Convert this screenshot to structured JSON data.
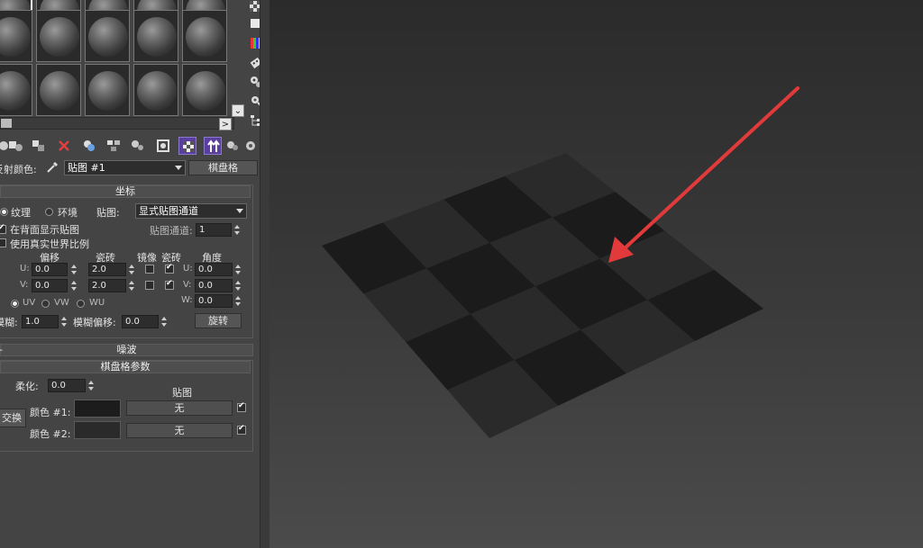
{
  "editor": {
    "reflect_color_label": "反射颜色:",
    "map_name": "贴图 #1",
    "map_type_button": "棋盘格",
    "scroll_right": ">",
    "scroll_down": "⌄"
  },
  "coordinates": {
    "title": "坐标",
    "texture_label": "纹理",
    "environ_label": "环境",
    "mapping_label": "贴图:",
    "mapping_value": "显式贴图通道",
    "map_channel_label": "贴图通道:",
    "map_channel_value": "1",
    "show_back_label": "在背面显示贴图",
    "real_world_label": "使用真实世界比例",
    "offset_header": "偏移",
    "tiling_header": "瓷砖",
    "mirror_header": "镜像",
    "tile_header": "瓷砖",
    "angle_header": "角度",
    "u_label": "U:",
    "v_label": "V:",
    "w_label": "W:",
    "offset_u": "0.0",
    "offset_v": "0.0",
    "tiling_u": "2.0",
    "tiling_v": "2.0",
    "angle_u": "0.0",
    "angle_v": "0.0",
    "angle_w": "0.0",
    "uv_label": "UV",
    "vw_label": "VW",
    "wu_label": "WU",
    "blur_label": "模糊:",
    "blur_value": "1.0",
    "blur_offset_label": "模糊偏移:",
    "blur_offset_value": "0.0",
    "rotate_button": "旋转"
  },
  "noise": {
    "title": "噪波",
    "sign": "-"
  },
  "checker": {
    "title": "棋盘格参数",
    "soften_label": "柔化:",
    "soften_value": "0.0",
    "maps_header": "贴图",
    "swap_button": "交换",
    "color1_label": "颜色 #1:",
    "color2_label": "颜色 #2:",
    "map1_button": "无",
    "map2_button": "无",
    "color1": "#1c1c1c",
    "color2": "#2a2a2a"
  },
  "viewport": {
    "checker_dark": "#1b1b1b",
    "checker_light": "#2a2a2a",
    "arrow_color": "#e23a3a"
  }
}
